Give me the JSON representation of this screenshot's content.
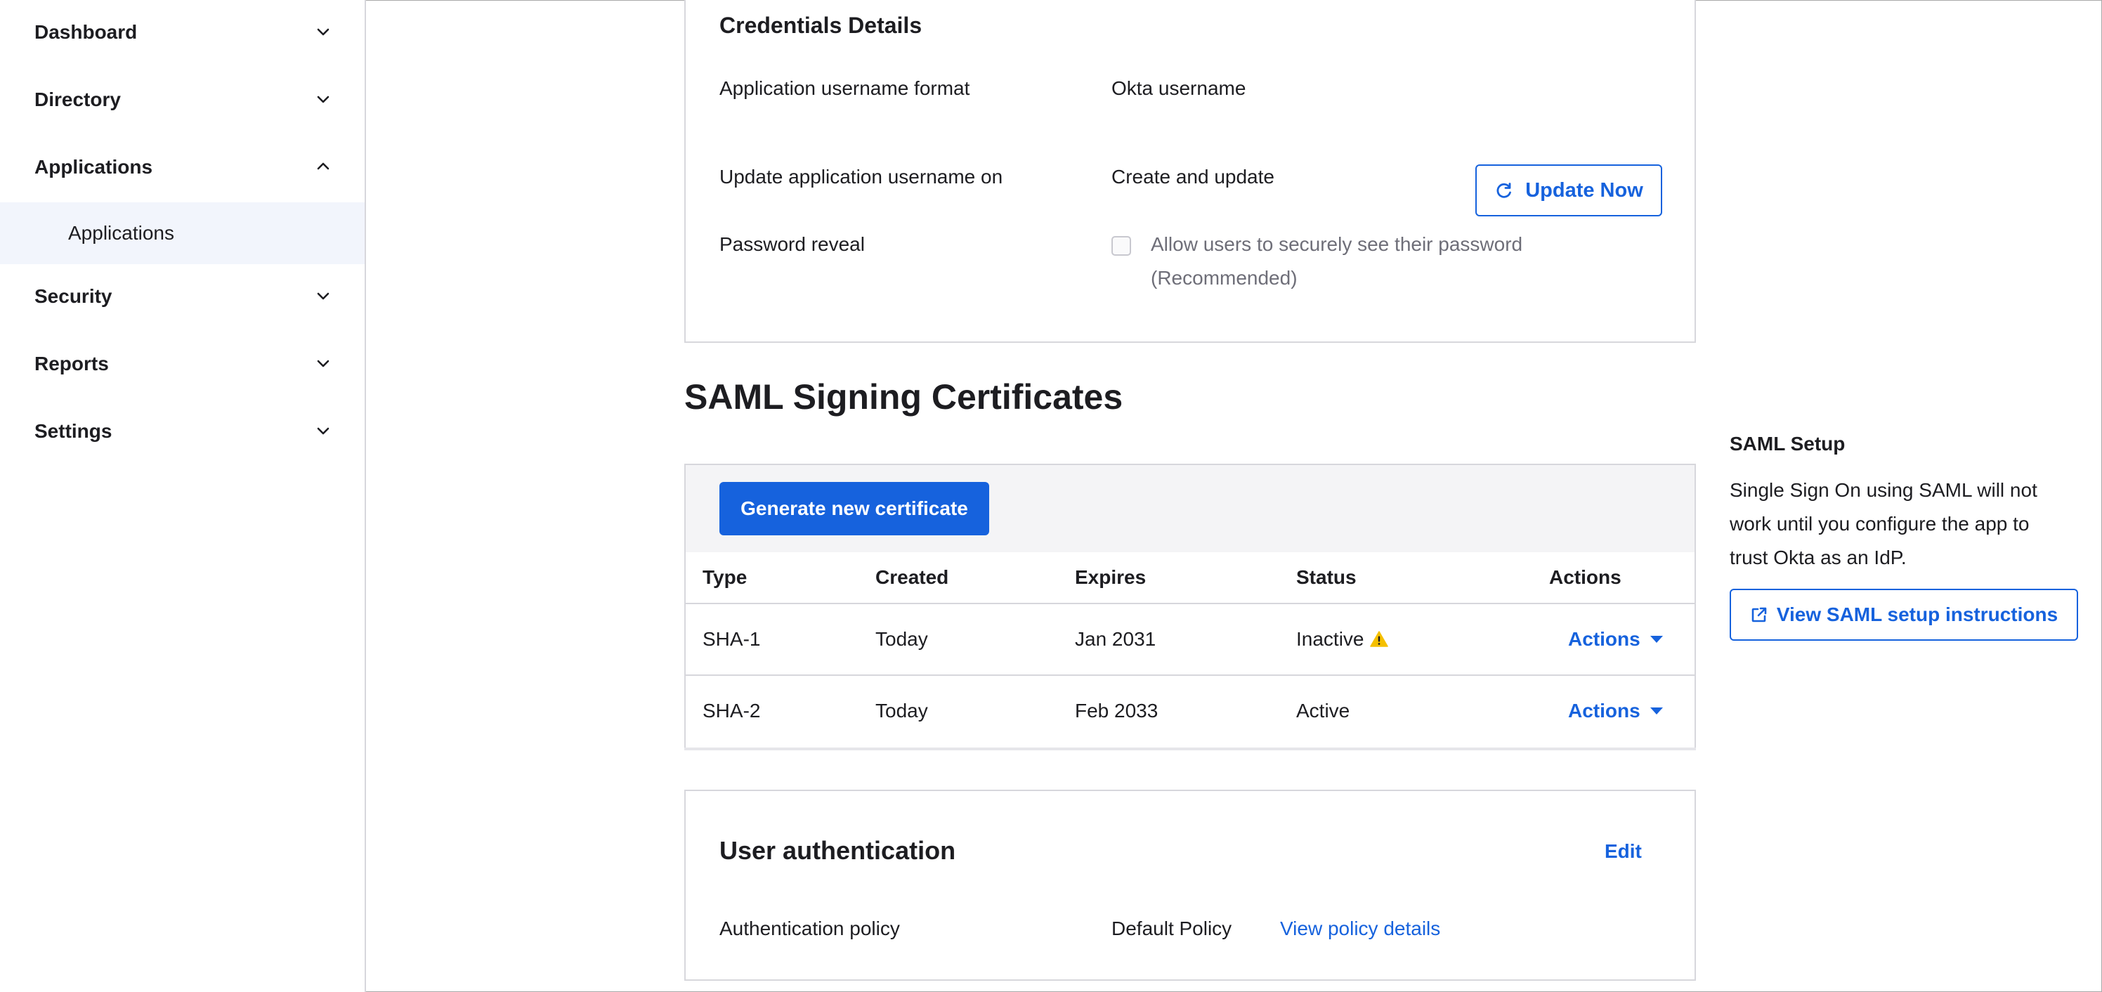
{
  "sidebar": {
    "items": [
      {
        "label": "Dashboard",
        "expanded": false
      },
      {
        "label": "Directory",
        "expanded": false
      },
      {
        "label": "Applications",
        "expanded": true,
        "children": [
          {
            "label": "Applications",
            "selected": true
          }
        ]
      },
      {
        "label": "Security",
        "expanded": false
      },
      {
        "label": "Reports",
        "expanded": false
      },
      {
        "label": "Settings",
        "expanded": false
      }
    ]
  },
  "credentials": {
    "title": "Credentials Details",
    "rows": [
      {
        "label": "Application username format",
        "value": "Okta username"
      },
      {
        "label": "Update application username on",
        "value": "Create and update"
      },
      {
        "label": "Password reveal"
      }
    ],
    "update_now_label": "Update Now",
    "password_checkbox_line1": "Allow users to securely see their password",
    "password_checkbox_line2": "(Recommended)",
    "password_checkbox_checked": false
  },
  "saml_certs": {
    "title": "SAML Signing Certificates",
    "generate_label": "Generate new certificate",
    "columns": [
      "Type",
      "Created",
      "Expires",
      "Status",
      "Actions"
    ],
    "rows": [
      {
        "type": "SHA-1",
        "created": "Today",
        "expires": "Jan 2031",
        "status": "Inactive",
        "warning": true,
        "action": "Actions"
      },
      {
        "type": "SHA-2",
        "created": "Today",
        "expires": "Feb 2033",
        "status": "Active",
        "warning": false,
        "action": "Actions"
      }
    ]
  },
  "user_auth": {
    "title": "User authentication",
    "edit_label": "Edit",
    "policy_label": "Authentication policy",
    "policy_value": "Default Policy",
    "policy_link": "View policy details"
  },
  "saml_setup": {
    "title": "SAML Setup",
    "desc_line1": "Single Sign On using SAML will not",
    "desc_line2": "work until you configure the app to",
    "desc_line3": "trust Okta as an IdP.",
    "button_label": "View SAML setup instructions"
  },
  "colors": {
    "accent": "#1662dd",
    "warning": "#f5c000",
    "selected_bg": "#f2f5fc"
  }
}
